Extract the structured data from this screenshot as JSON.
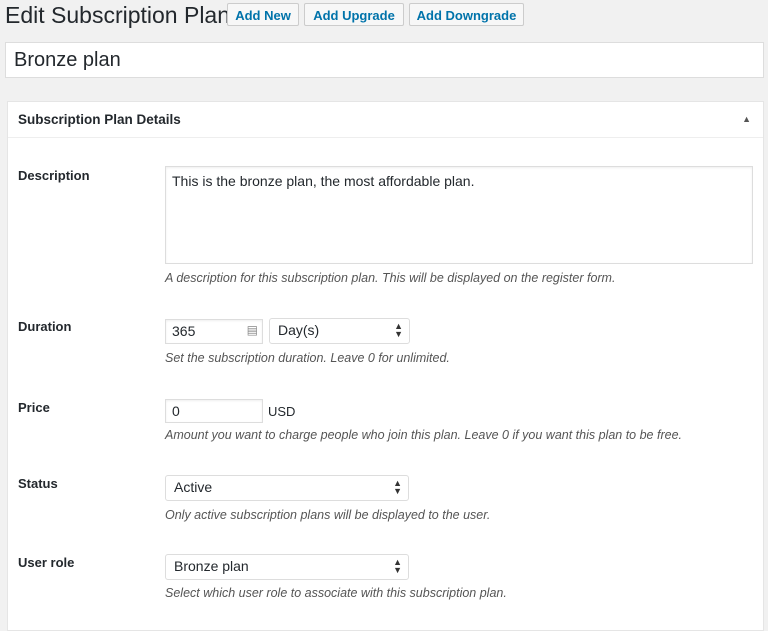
{
  "header": {
    "title": "Edit Subscription Plan",
    "buttons": [
      "Add New",
      "Add Upgrade",
      "Add Downgrade"
    ]
  },
  "plan_title": "Bronze plan",
  "box": {
    "title": "Subscription Plan Details",
    "toggle_icon": "triangle-up-icon"
  },
  "fields": {
    "description": {
      "label": "Description",
      "value": "This is the bronze plan, the most affordable plan.",
      "help": "A description for this subscription plan. This will be displayed on the register form."
    },
    "duration": {
      "label": "Duration",
      "value": "365",
      "unit": "Day(s)",
      "help": "Set the subscription duration. Leave 0 for unlimited."
    },
    "price": {
      "label": "Price",
      "value": "0",
      "currency": "USD",
      "help": "Amount you want to charge people who join this plan. Leave 0 if you want this plan to be free."
    },
    "status": {
      "label": "Status",
      "value": "Active",
      "help": "Only active subscription plans will be displayed to the user."
    },
    "user_role": {
      "label": "User role",
      "value": "Bronze plan",
      "help": "Select which user role to associate with this subscription plan."
    }
  }
}
